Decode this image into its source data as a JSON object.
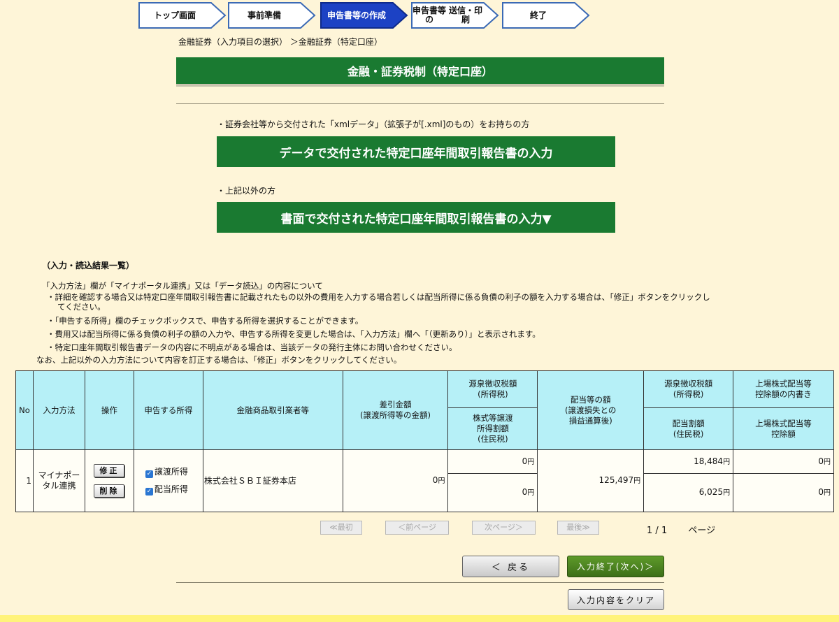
{
  "steps": [
    {
      "label": "トップ画面",
      "active": false
    },
    {
      "label": "事前準備",
      "active": false
    },
    {
      "label": "申告書等の作成",
      "label_line1": "申告書等の",
      "label_line2": "作成",
      "active": true
    },
    {
      "label": "申告書等の送信・印刷",
      "label_line1": "申告書等の",
      "label_line2": "送信・印刷",
      "active": false
    },
    {
      "label": "終了",
      "active": false
    }
  ],
  "breadcrumb": "金融証券（入力項目の選択） ＞金融証券（特定口座）",
  "page_title": "金融・証券税制（特定口座）",
  "xml_note": "・証券会社等から交付された「xmlデータ」（拡張子が[.xml]のもの）をお持ちの方",
  "xml_button": "データで交付された特定口座年間取引報告書の入力",
  "other_note": "・上記以外の方",
  "paper_button": "書面で交付された特定口座年間取引報告書の入力▼",
  "results": {
    "heading": "（入力・読込結果一覧）",
    "instructions": [
      "「入力方法」欄が「マイナポータル連携」又は「データ読込」の内容について",
      "・詳細を確認する場合又は特定口座年間取引報告書に記載されたもの以外の費用を入力する場合若しくは配当所得に係る負債の利子の額を入力する場合は、「修正」ボタンをクリックし",
      "てください。",
      "・「申告する所得」欄のチェックボックスで、申告する所得を選択することができます。",
      "・費用又は配当所得に係る負債の利子の額の入力や、申告する所得を変更した場合は、「入力方法」欄へ「（更新あり）」と表示されます。",
      "・特定口座年間取引報告書データの内容に不明点がある場合は、当該データの発行主体にお問い合わせください。",
      "なお、上記以外の入力方法について内容を訂正する場合は、「修正」ボタンをクリックしてください。"
    ],
    "headers": {
      "no": "No",
      "method": "入力方法",
      "operation": "操作",
      "income": "申告する所得",
      "broker": "金融商品取引業者等",
      "net_amount": [
        "差引金額",
        "(譲渡所得等の金額)"
      ],
      "withholding_income": [
        "源泉徴収税額",
        "(所得税)"
      ],
      "stock_transfer": [
        "株式等譲渡",
        "所得割額",
        "(住民税)"
      ],
      "dividend": [
        "配当等の額",
        "(譲渡損失との",
        "損益通算後)"
      ],
      "withholding_income2": [
        "源泉徴収税額",
        "(所得税)"
      ],
      "dividend_split": [
        "配当割額",
        "(住民税)"
      ],
      "listed_breakdown": [
        "上場株式配当等",
        "控除額の内書き"
      ],
      "listed_deduction": [
        "上場株式配当等",
        "控除額"
      ]
    },
    "rows": [
      {
        "no": "1",
        "method": "マイナポータル連携",
        "fix_label": "修正",
        "delete_label": "削除",
        "income_options": [
          {
            "label": "譲渡所得",
            "checked": true
          },
          {
            "label": "配当所得",
            "checked": true
          }
        ],
        "broker": "株式会社ＳＢＩ証券本店",
        "net_amount": "0",
        "withholding_income": "0",
        "stock_transfer": "0",
        "dividend": "125,497",
        "withholding_income2": "18,484",
        "dividend_split": "6,025",
        "listed_breakdown": "0",
        "listed_deduction": "0",
        "unit": "円"
      }
    ]
  },
  "pagination": {
    "first": "≪最初",
    "prev": "＜前ページ",
    "next": "次ページ＞",
    "last": "最後≫",
    "current": "1",
    "total": "1",
    "separator": "/",
    "page_label": "ページ"
  },
  "nav": {
    "back": "＜ 戻る",
    "finish": "入力終了(次へ)＞",
    "clear": "入力内容をクリア"
  },
  "colors": {
    "background": "#fef5d8",
    "green": "#1a7a31",
    "active_step": "#1c42c4",
    "table_header": "#b6f0f7"
  }
}
